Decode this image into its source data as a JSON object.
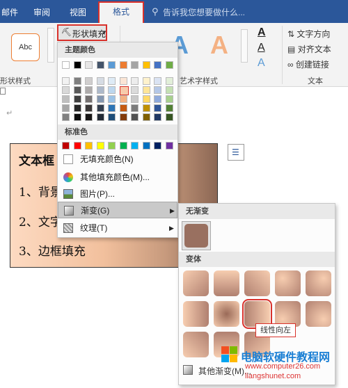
{
  "tabs": {
    "mailings": "邮件",
    "review": "审阅",
    "view": "视图",
    "format": "格式"
  },
  "search": {
    "text": "告诉我您想要做什么..."
  },
  "ribbon": {
    "style_sample": "Abc",
    "shape_fill": "形状填充",
    "text_direction": "文字方向",
    "align_text": "对齐文本",
    "create_link": "创建链接",
    "group_shape_styles": "形状样式",
    "group_art_styles": "艺术字样式",
    "group_text": "文本",
    "wordart_a": "A"
  },
  "menu": {
    "theme_colors": "主题颜色",
    "standard_colors": "标准色",
    "no_fill": "无填充颜色(N)",
    "more_colors": "其他填充颜色(M)...",
    "picture": "图片(P)...",
    "gradient": "渐变(G)",
    "texture": "纹理(T)"
  },
  "submenu": {
    "no_gradient": "无渐变",
    "variants": "变体",
    "more_gradients": "其他渐变(M)...",
    "tooltip": "线性向左"
  },
  "textbox": {
    "line1": "文本框",
    "line2": "1、背景",
    "line3": "2、文字",
    "line4": "3、边框填充"
  },
  "watermark": {
    "title": "电脑软硬件教程网",
    "url": "www.computer26.com",
    "url2": "liangshunet.com"
  },
  "theme_palette": [
    [
      "#ffffff",
      "#f2f2f2",
      "#d9d9d9",
      "#bfbfbf",
      "#a6a6a6",
      "#808080"
    ],
    [
      "#000000",
      "#7f7f7f",
      "#595959",
      "#3f3f3f",
      "#262626",
      "#0d0d0d"
    ],
    [
      "#e7e6e6",
      "#d0cece",
      "#aeabab",
      "#757171",
      "#3b3838",
      "#181717"
    ],
    [
      "#44546a",
      "#d6dce4",
      "#adb9ca",
      "#8497b0",
      "#333f4f",
      "#222a35"
    ],
    [
      "#5b9bd5",
      "#deebf6",
      "#bdd7ee",
      "#9dc3e6",
      "#2e75b5",
      "#1e4e79"
    ],
    [
      "#ed7d31",
      "#fbe5d5",
      "#f7cbac",
      "#f4b183",
      "#c55a11",
      "#843c0b"
    ],
    [
      "#a5a5a5",
      "#ededed",
      "#dbdbdb",
      "#c9c9c9",
      "#7b7b7b",
      "#525252"
    ],
    [
      "#ffc000",
      "#fff2cc",
      "#fee599",
      "#ffd966",
      "#bf9000",
      "#7f6000"
    ],
    [
      "#4472c4",
      "#dae3f3",
      "#b4c7e7",
      "#8faadc",
      "#2f5597",
      "#203864"
    ],
    [
      "#70ad47",
      "#e2efd9",
      "#c5e0b3",
      "#a8d08d",
      "#538135",
      "#375623"
    ]
  ],
  "standard_palette": [
    "#c00000",
    "#ff0000",
    "#ffc000",
    "#ffff00",
    "#92d050",
    "#00b050",
    "#00b0f0",
    "#0070c0",
    "#002060",
    "#7030a0"
  ]
}
